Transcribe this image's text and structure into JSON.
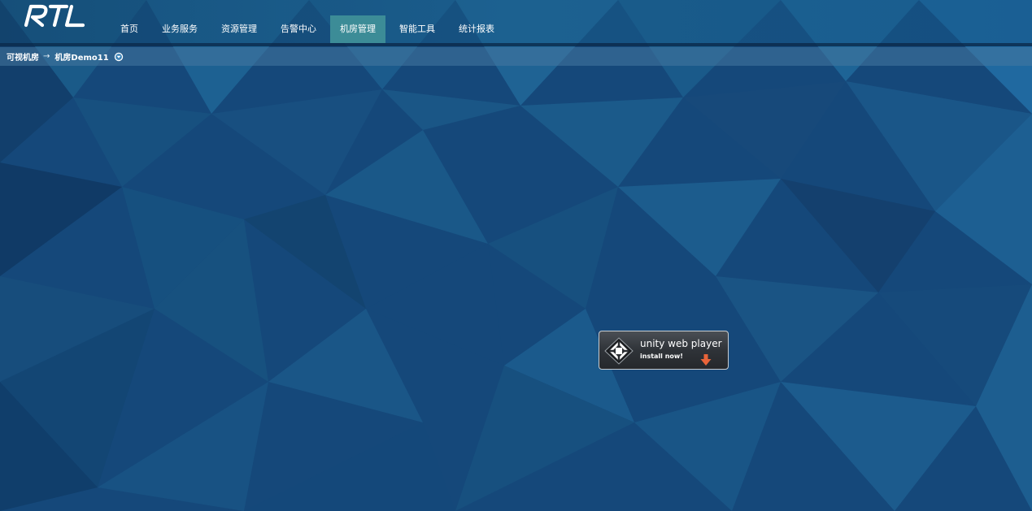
{
  "header": {
    "logo_text": "RTL",
    "nav": [
      {
        "label": "首页",
        "active": false
      },
      {
        "label": "业务服务",
        "active": false
      },
      {
        "label": "资源管理",
        "active": false
      },
      {
        "label": "告警中心",
        "active": false
      },
      {
        "label": "机房管理",
        "active": true
      },
      {
        "label": "智能工具",
        "active": false
      },
      {
        "label": "统计报表",
        "active": false
      }
    ]
  },
  "breadcrumb": {
    "root": "可视机房",
    "separator": "→",
    "current": "机房Demo11",
    "dropdown_icon": "chevron-down-circle-icon"
  },
  "unity_player": {
    "title": "unity web player",
    "subtitle": "install now!",
    "logo_icon": "unity-logo-icon",
    "download_icon": "download-arrow-icon"
  },
  "colors": {
    "background": "#15487a",
    "nav_active": "#3c8c97",
    "breadcrumb_bar": "#4a7ba3",
    "download_arrow": "#e8643a"
  }
}
